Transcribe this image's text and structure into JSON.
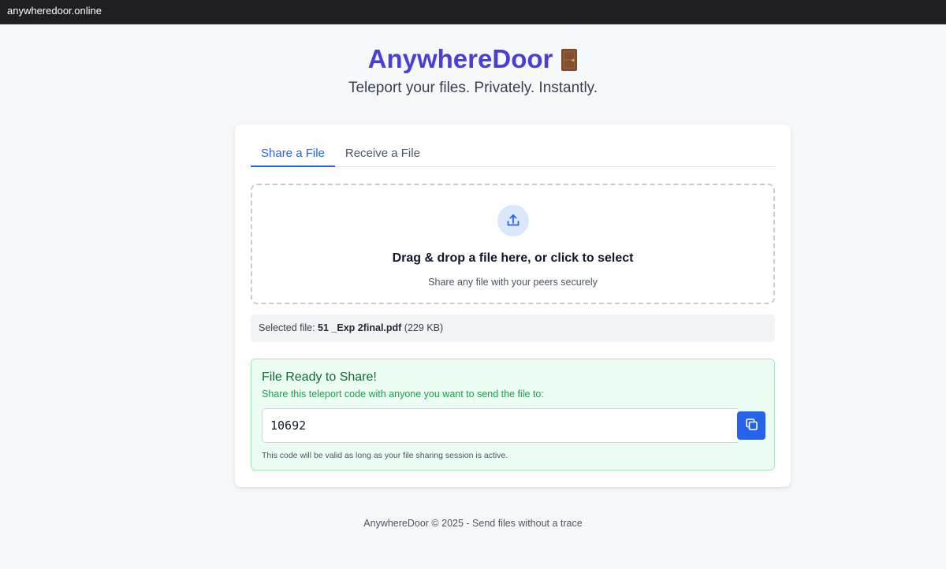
{
  "browser": {
    "url": "anywheredoor.online"
  },
  "header": {
    "title": "AnywhereDoor",
    "tagline": "Teleport your files. Privately. Instantly."
  },
  "tabs": [
    {
      "label": "Share a File",
      "active": true
    },
    {
      "label": "Receive a File",
      "active": false
    }
  ],
  "dropzone": {
    "icon": "upload-icon",
    "title": "Drag & drop a file here, or click to select",
    "subtitle": "Share any file with your peers securely"
  },
  "selected_file": {
    "prefix": "Selected file: ",
    "name": "51 _Exp 2final.pdf",
    "size": " (229 KB)"
  },
  "ready_panel": {
    "title": "File Ready to Share!",
    "subtitle": "Share this teleport code with anyone you want to send the file to:",
    "code": "10692",
    "copy_icon": "copy-icon",
    "note": "This code will be valid as long as your file sharing session is active."
  },
  "footer": {
    "text": "AnywhereDoor © 2025 - Send files without a trace"
  },
  "colors": {
    "brand": "#4a3ed6",
    "accent": "#2563eb",
    "success_bg": "#ecfdf3",
    "success_text": "#16a34a"
  }
}
